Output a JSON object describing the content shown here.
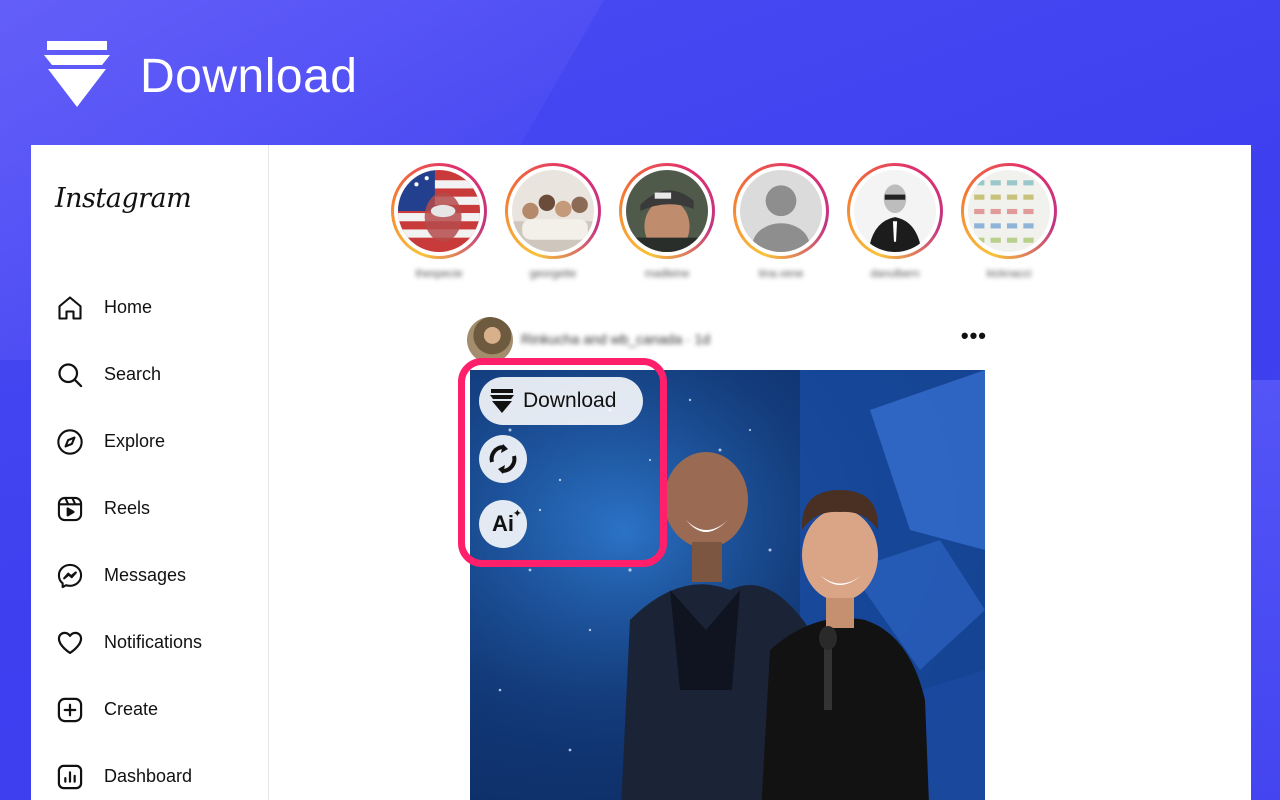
{
  "hero": {
    "title": "Download",
    "logo_icon": "download-arrow-icon"
  },
  "app": {
    "brand": "Instagram",
    "sidebar": {
      "items": [
        {
          "label": "Home",
          "icon": "home-icon"
        },
        {
          "label": "Search",
          "icon": "search-icon"
        },
        {
          "label": "Explore",
          "icon": "compass-icon"
        },
        {
          "label": "Reels",
          "icon": "reels-icon"
        },
        {
          "label": "Messages",
          "icon": "messenger-icon"
        },
        {
          "label": "Notifications",
          "icon": "heart-icon"
        },
        {
          "label": "Create",
          "icon": "plus-square-icon"
        },
        {
          "label": "Dashboard",
          "icon": "dashboard-icon"
        }
      ]
    },
    "stories": [
      {
        "name": "thespecie",
        "style": "flag"
      },
      {
        "name": "georgette",
        "style": "group"
      },
      {
        "name": "madleine",
        "style": "cap"
      },
      {
        "name": "tina.vene",
        "style": "default-avatar"
      },
      {
        "name": "danulbern",
        "style": "suit"
      },
      {
        "name": "kicknacci",
        "style": "sneakers"
      }
    ],
    "post": {
      "user": "Rinkucha and wb_canada · 1d",
      "more": "•••"
    },
    "overlay": {
      "download_label": "Download",
      "rotate_icon": "rotate-icon",
      "ai_label": "Ai",
      "ai_spark": "✦",
      "frame_color": "#ff1f6a"
    }
  }
}
